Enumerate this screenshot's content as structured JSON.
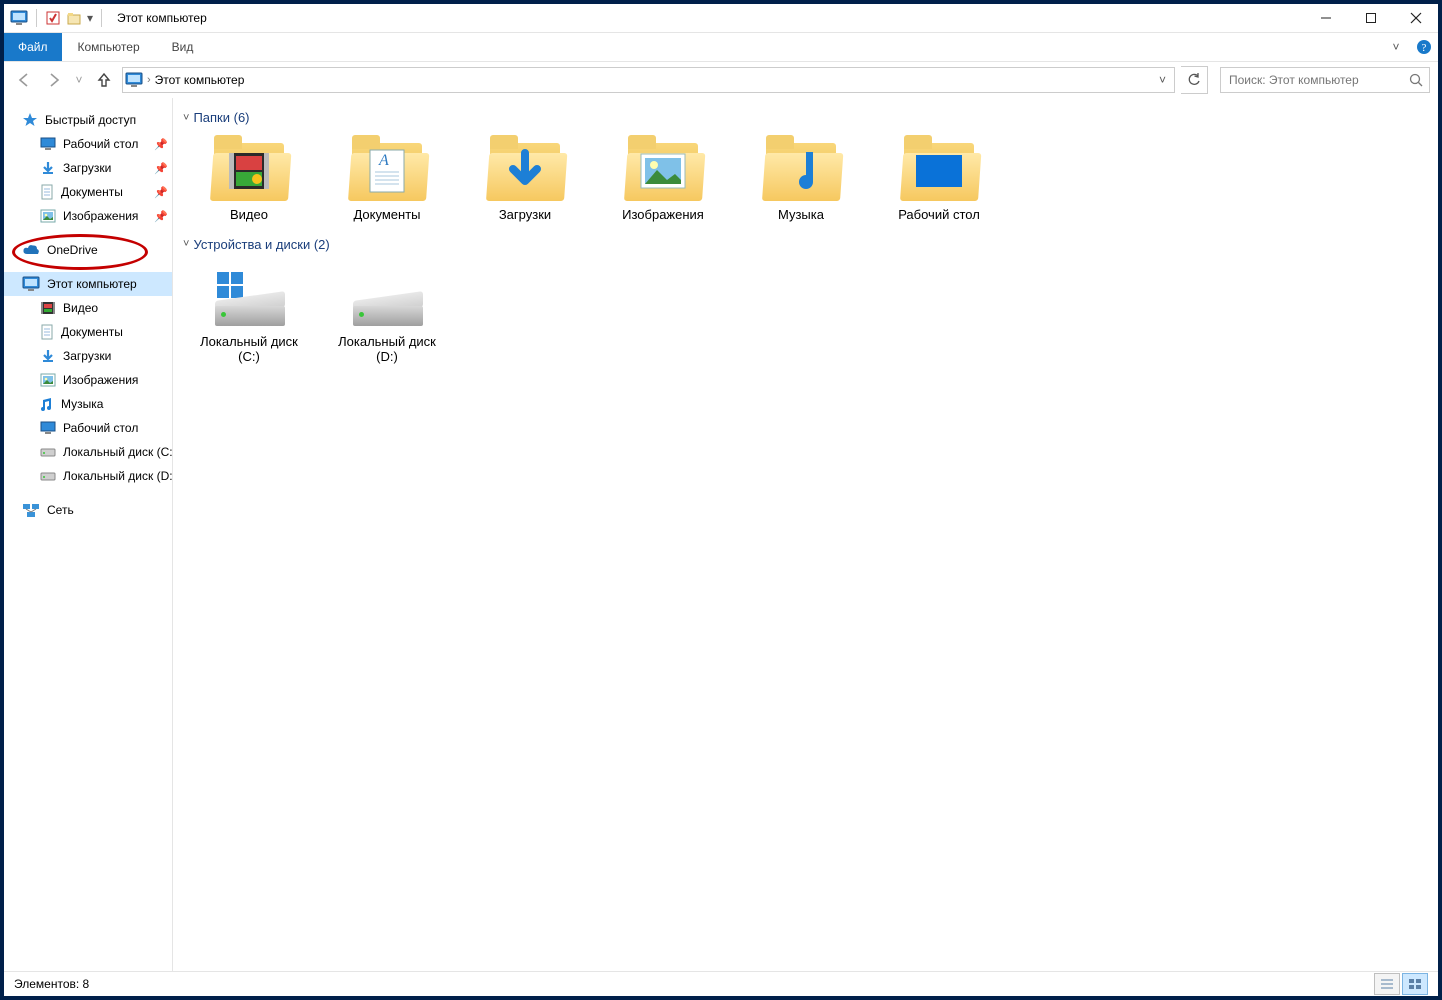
{
  "title": "Этот компьютер",
  "ribbon": {
    "file": "Файл",
    "computer": "Компьютер",
    "view": "Вид"
  },
  "address": {
    "location": "Этот компьютер"
  },
  "search": {
    "placeholder": "Поиск: Этот компьютер"
  },
  "sidebar": {
    "quick_access": "Быстрый доступ",
    "quick_items": [
      {
        "label": "Рабочий стол",
        "icon": "desktop",
        "pinned": true
      },
      {
        "label": "Загрузки",
        "icon": "download",
        "pinned": true
      },
      {
        "label": "Документы",
        "icon": "document",
        "pinned": true
      },
      {
        "label": "Изображения",
        "icon": "picture",
        "pinned": true
      }
    ],
    "onedrive": "OneDrive",
    "this_pc": "Этот компьютер",
    "pc_items": [
      {
        "label": "Видео",
        "icon": "video"
      },
      {
        "label": "Документы",
        "icon": "document"
      },
      {
        "label": "Загрузки",
        "icon": "download"
      },
      {
        "label": "Изображения",
        "icon": "picture"
      },
      {
        "label": "Музыка",
        "icon": "music"
      },
      {
        "label": "Рабочий стол",
        "icon": "desktop"
      },
      {
        "label": "Локальный диск (C:)",
        "icon": "drive"
      },
      {
        "label": "Локальный диск (D:)",
        "icon": "drive"
      }
    ],
    "network": "Сеть"
  },
  "content": {
    "folders_header": "Папки (6)",
    "folders": [
      {
        "label": "Видео",
        "icon": "video"
      },
      {
        "label": "Документы",
        "icon": "document"
      },
      {
        "label": "Загрузки",
        "icon": "download"
      },
      {
        "label": "Изображения",
        "icon": "picture"
      },
      {
        "label": "Музыка",
        "icon": "music"
      },
      {
        "label": "Рабочий стол",
        "icon": "desktop"
      }
    ],
    "drives_header": "Устройства и диски (2)",
    "drives": [
      {
        "label": "Локальный диск (C:)",
        "os": true
      },
      {
        "label": "Локальный диск (D:)",
        "os": false
      }
    ]
  },
  "status": {
    "count": "Элементов: 8"
  }
}
